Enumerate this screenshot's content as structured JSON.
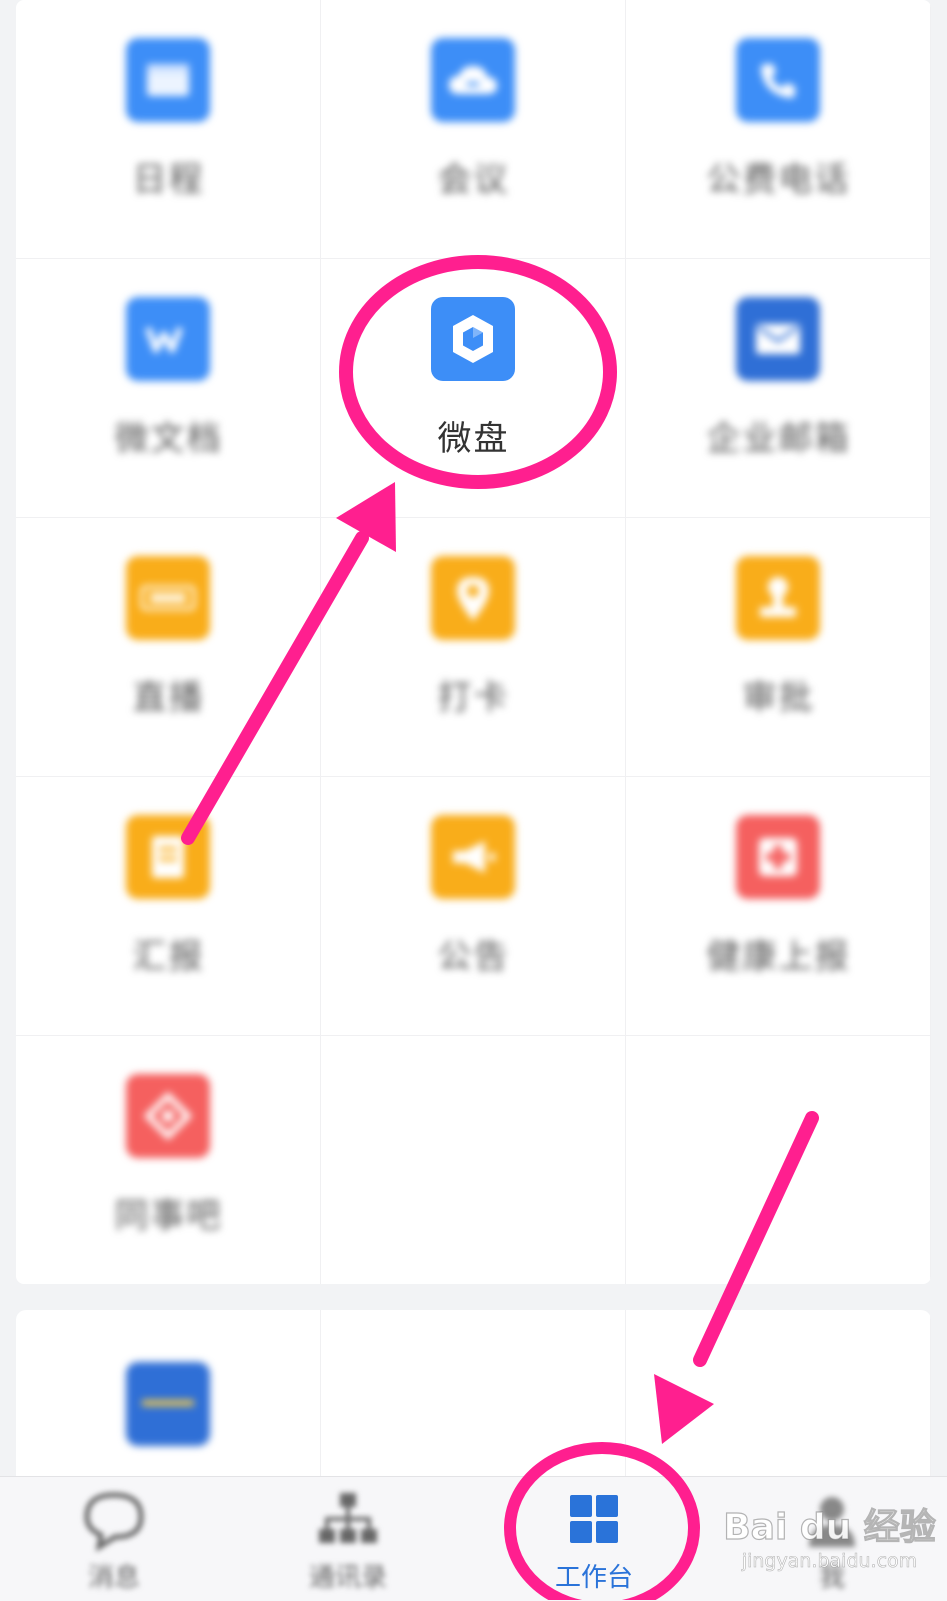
{
  "apps_main": [
    {
      "label": "日程",
      "icon": "calendar-icon",
      "color": "#3d8ef7",
      "emphasized": false
    },
    {
      "label": "会议",
      "icon": "cloud-meeting-icon",
      "color": "#3d8ef7",
      "emphasized": false
    },
    {
      "label": "公费电话",
      "icon": "phone-icon",
      "color": "#3d8ef7",
      "emphasized": false
    },
    {
      "label": "微文档",
      "icon": "document-w-icon",
      "color": "#3d8ef7",
      "emphasized": false
    },
    {
      "label": "微盘",
      "icon": "drive-cube-icon",
      "color": "#3d8ef7",
      "emphasized": true
    },
    {
      "label": "企业邮箱",
      "icon": "mail-icon",
      "color": "#2f6fd6",
      "emphasized": false
    },
    {
      "label": "直播",
      "icon": "live-icon",
      "color": "#f9ad1a",
      "emphasized": false
    },
    {
      "label": "打卡",
      "icon": "location-pin-icon",
      "color": "#f9ad1a",
      "emphasized": false
    },
    {
      "label": "审批",
      "icon": "stamp-icon",
      "color": "#f9ad1a",
      "emphasized": false
    },
    {
      "label": "汇报",
      "icon": "report-icon",
      "color": "#f9ad1a",
      "emphasized": false
    },
    {
      "label": "公告",
      "icon": "megaphone-icon",
      "color": "#f9ad1a",
      "emphasized": false
    },
    {
      "label": "健康上报",
      "icon": "health-cross-icon",
      "color": "#f5605f",
      "emphasized": false
    },
    {
      "label": "同事吧",
      "icon": "colleague-circle-icon",
      "color": "#f5605f",
      "emphasized": false
    }
  ],
  "apps_second": [
    {
      "label": "",
      "icon": "card-icon",
      "color": "#2f6fd6"
    }
  ],
  "tabbar": {
    "tabs": [
      {
        "label": "消息",
        "icon": "chat-bubble-icon",
        "active": false
      },
      {
        "label": "通讯录",
        "icon": "org-chart-icon",
        "active": false
      },
      {
        "label": "工作台",
        "icon": "workbench-grid-icon",
        "active": true
      },
      {
        "label": "我",
        "icon": "person-icon",
        "active": false
      }
    ]
  },
  "watermark": {
    "logo_text": "Bai du 经验",
    "url_text": "jingyan.baidu.com"
  },
  "colors": {
    "annotation": "#ff1f8f",
    "active_tab": "#2a73d9"
  }
}
